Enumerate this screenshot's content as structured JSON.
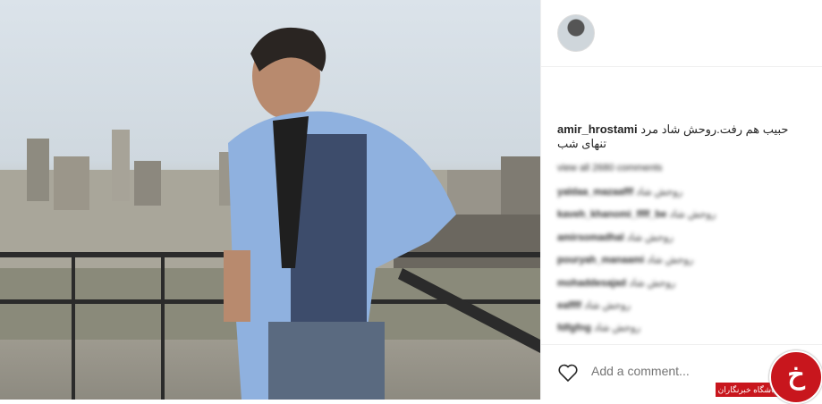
{
  "post": {
    "username": "amir_hrostami",
    "caption_line1": "حبیب هم رفت.روحش شاد مرد",
    "caption_line2": "تنهای شب"
  },
  "comments": [
    {
      "user": "view all 2680 comments",
      "text": ""
    },
    {
      "user": "yaldaa_mazaafff",
      "text": "روحش شاد"
    },
    {
      "user": "kaveh_khanomi_ffff_be",
      "text": "روحش شاد"
    },
    {
      "user": "amirsomadhal",
      "text": "روحش شاد"
    },
    {
      "user": "pouryah_manaami",
      "text": "روحش شاد"
    },
    {
      "user": "mohaddesajad",
      "text": "روحش شاد"
    },
    {
      "user": "eaffff",
      "text": "روحش شاد"
    },
    {
      "user": "fdfgfng",
      "text": "روحش شاد"
    }
  ],
  "footer": {
    "add_comment_placeholder": "Add a comment..."
  },
  "watermark": {
    "text": "باشگاه خبرنگاران",
    "logo_glyph": "خ"
  },
  "colors": {
    "brand_red": "#c8161d",
    "text": "#262626",
    "placeholder": "#999999"
  }
}
